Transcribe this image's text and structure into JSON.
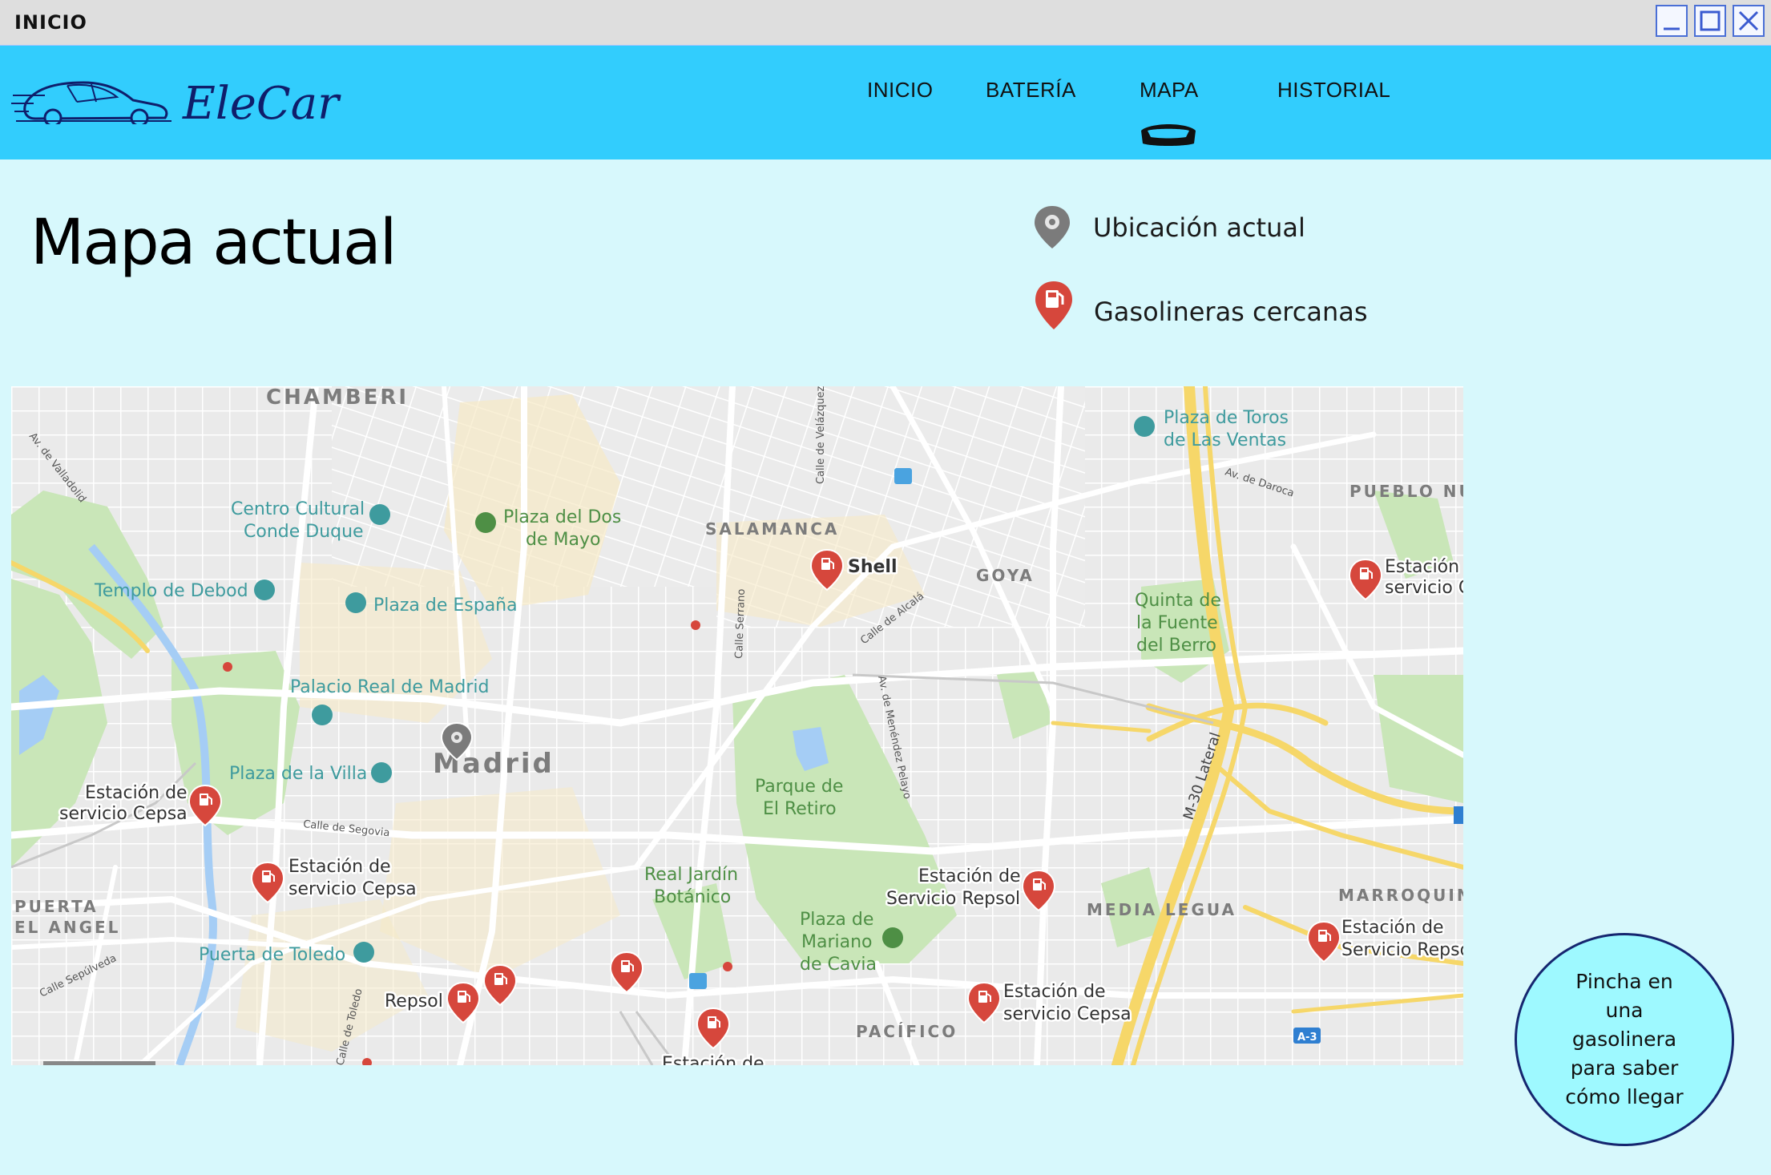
{
  "window": {
    "title": "INICIO"
  },
  "header": {
    "brand": "EleCar",
    "nav": [
      {
        "label": "INICIO"
      },
      {
        "label": "BATERÍA"
      },
      {
        "label": "MAPA"
      },
      {
        "label": "HISTORIAL"
      }
    ]
  },
  "page": {
    "title": "Mapa actual"
  },
  "legend": {
    "current_location": "Ubicación actual",
    "nearby_stations": "Gasolineras cercanas"
  },
  "map": {
    "areas": {
      "chamberi": "CHAMBERI",
      "salamanca": "SALAMANCA",
      "goya": "GOYA",
      "pueblo_nuevo": "PUEBLO NU",
      "madrid": "Madrid",
      "puerta_angel_1": "PUERTA",
      "puerta_angel_2": "EL ANGEL",
      "media_legua": "MEDIA LEGUA",
      "marroquina": "MARROQUIN",
      "pacifico": "PACÍFICO"
    },
    "places": {
      "plaza_toros_1": "Plaza de Toros",
      "plaza_toros_2": "de Las Ventas",
      "centro_cultural_1": "Centro Cultural",
      "centro_cultural_2": "Conde Duque",
      "plaza_dos_mayo_1": "Plaza del Dos",
      "plaza_dos_mayo_2": "de Mayo",
      "templo_debod": "Templo de Debod",
      "plaza_espana": "Plaza de España",
      "quinta_1": "Quinta de",
      "quinta_2": "la Fuente",
      "quinta_3": "del Berro",
      "palacio_real": "Palacio Real de Madrid",
      "plaza_villa": "Plaza de la Villa",
      "retiro_1": "Parque de",
      "retiro_2": "El Retiro",
      "jardin_1": "Real Jardín",
      "jardin_2": "Botánico",
      "mariano_1": "Plaza de",
      "mariano_2": "Mariano",
      "mariano_3": "de Cavia",
      "puerta_toledo": "Puerta de Toledo"
    },
    "streets": {
      "valladolid": "Av. de Valladolid",
      "velazquez": "Calle de Velázquez",
      "serrano": "Calle Serrano",
      "alcala": "Calle de Alcalá",
      "menendez": "Av. de Menéndez Pelayo",
      "daroca": "Av. de Daroca",
      "m30": "M-30 Lateral",
      "segovia": "Calle de Segovia",
      "sepulveda": "Calle Sepúlveda",
      "toledo": "Calle de Toledo",
      "a3": "A-3"
    },
    "stations": {
      "shell": "Shell",
      "est_right_1": "Estación",
      "est_right_2": "servicio C",
      "cepsa_w_1": "Estación de",
      "cepsa_w_2": "servicio Cepsa",
      "cepsa_sw_1": "Estación de",
      "cepsa_sw_2": "servicio Cepsa",
      "repsol_1": "Estación de",
      "repsol_2": "Servicio Repsol",
      "repsol_e_1": "Estación de",
      "repsol_e_2": "Servicio Repso",
      "cepsa_s_1": "Estación de",
      "cepsa_s_2": "servicio Cepsa",
      "repsol_small": "Repsol",
      "cut_label": "Estación de"
    }
  },
  "hint": {
    "text": "Pincha en una gasolinera para saber cómo llegar"
  },
  "colors": {
    "navbar": "#32cdfd",
    "page_bg": "#d7f8fc",
    "hint_bg": "#9ef9ff",
    "pin_red": "#d6473c",
    "pin_gray": "#7b7b7b"
  }
}
